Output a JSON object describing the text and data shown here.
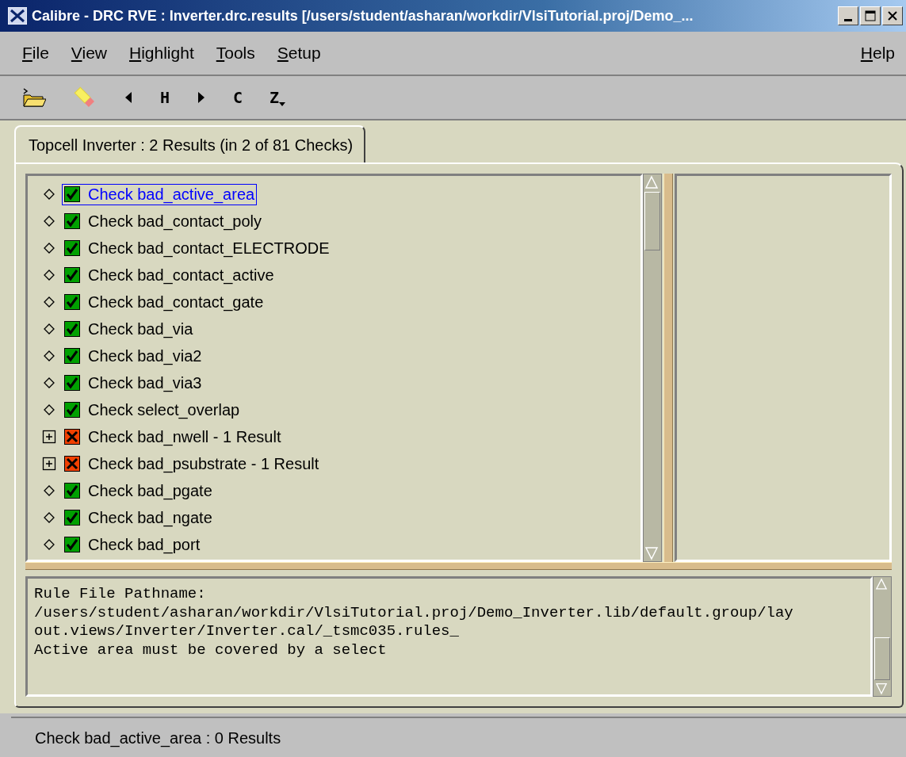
{
  "window": {
    "title": "Calibre - DRC RVE : Inverter.drc.results [/users/student/asharan/workdir/VlsiTutorial.proj/Demo_..."
  },
  "menus": [
    {
      "label": "File"
    },
    {
      "label": "View"
    },
    {
      "label": "Highlight"
    },
    {
      "label": "Tools"
    },
    {
      "label": "Setup"
    }
  ],
  "help_menu": {
    "label": "Help"
  },
  "toolbar": [
    {
      "kind": "open"
    },
    {
      "kind": "highlight"
    },
    {
      "kind": "prev"
    },
    {
      "kind": "text",
      "label": "H"
    },
    {
      "kind": "next"
    },
    {
      "kind": "text",
      "label": "C"
    },
    {
      "kind": "text",
      "label": "Z",
      "menu": true
    }
  ],
  "tabs": [
    {
      "label": "Topcell Inverter : 2 Results (in 2 of 81 Checks)",
      "selected": true
    }
  ],
  "checks": [
    {
      "label": "Check bad_active_area",
      "kind": "leaf",
      "passed": true,
      "selected": true
    },
    {
      "label": "Check bad_contact_poly",
      "kind": "leaf",
      "passed": true,
      "selected": false
    },
    {
      "label": "Check bad_contact_ELECTRODE",
      "kind": "leaf",
      "passed": true,
      "selected": false
    },
    {
      "label": "Check bad_contact_active",
      "kind": "leaf",
      "passed": true,
      "selected": false
    },
    {
      "label": "Check bad_contact_gate",
      "kind": "leaf",
      "passed": true,
      "selected": false
    },
    {
      "label": "Check bad_via",
      "kind": "leaf",
      "passed": true,
      "selected": false
    },
    {
      "label": "Check bad_via2",
      "kind": "leaf",
      "passed": true,
      "selected": false
    },
    {
      "label": "Check bad_via3",
      "kind": "leaf",
      "passed": true,
      "selected": false
    },
    {
      "label": "Check select_overlap",
      "kind": "leaf",
      "passed": true,
      "selected": false
    },
    {
      "label": "Check bad_nwell - 1 Result",
      "kind": "collapsed",
      "passed": false,
      "selected": false
    },
    {
      "label": "Check bad_psubstrate - 1 Result",
      "kind": "collapsed",
      "passed": false,
      "selected": false
    },
    {
      "label": "Check bad_pgate",
      "kind": "leaf",
      "passed": true,
      "selected": false
    },
    {
      "label": "Check bad_ngate",
      "kind": "leaf",
      "passed": true,
      "selected": false
    },
    {
      "label": "Check bad_port",
      "kind": "leaf",
      "passed": true,
      "selected": false
    }
  ],
  "details": {
    "lines": [
      "Rule File Pathname:",
      "/users/student/asharan/workdir/VlsiTutorial.proj/Demo_Inverter.lib/default.group/lay",
      "out.views/Inverter/Inverter.cal/_tsmc035.rules_",
      "Active area must be covered by a select"
    ]
  },
  "status_bar": "Check bad_active_area : 0 Results"
}
